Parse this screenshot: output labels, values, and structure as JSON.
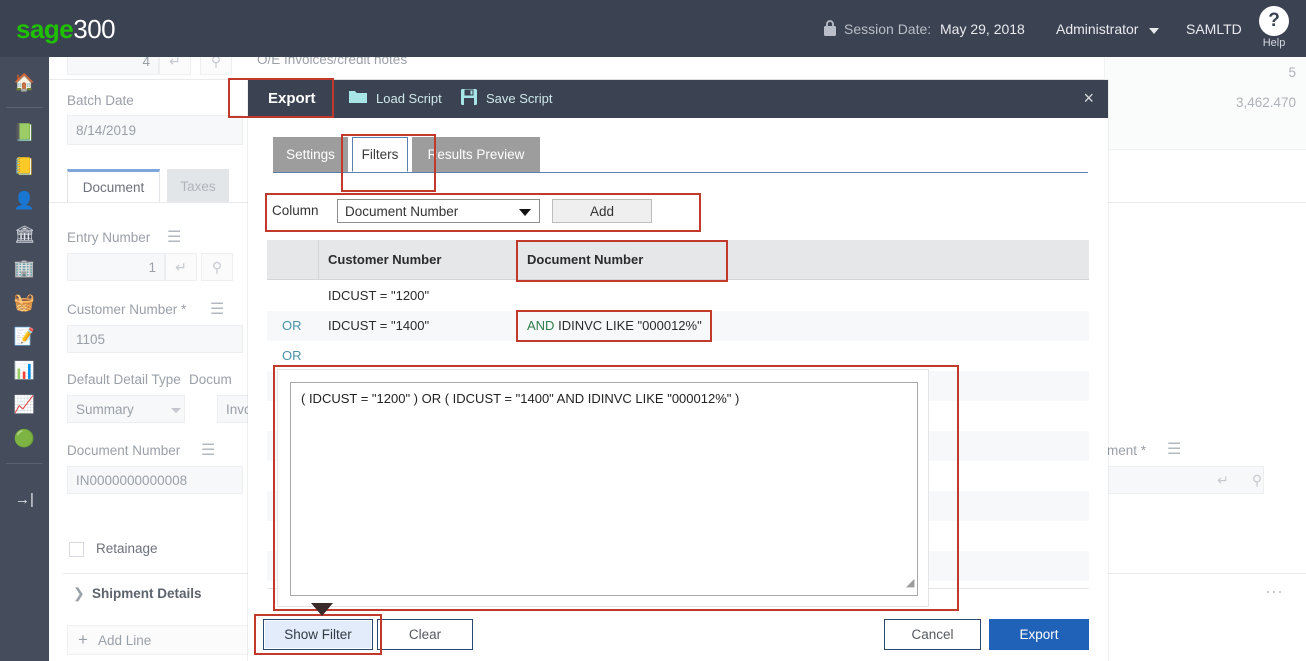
{
  "topbar": {
    "logo_sage": "sage",
    "logo_num": "300",
    "session_label": "Session Date:",
    "session_date": "May 29, 2018",
    "user": "Administrator",
    "company": "SAMLTD",
    "help_glyph": "?",
    "help_label": "Help",
    "bg_color": "#3b4251",
    "accent_green": "#1ec000"
  },
  "rail": {
    "items": [
      {
        "name": "home",
        "glyph": "🏠"
      },
      {
        "name": "accounts-payable",
        "glyph": "📗"
      },
      {
        "name": "accounts-receivable",
        "glyph": "📒"
      },
      {
        "name": "administrative-services",
        "glyph": "👤"
      },
      {
        "name": "bank-services",
        "glyph": "🏛"
      },
      {
        "name": "common-services",
        "glyph": "🏢"
      },
      {
        "name": "inventory-control",
        "glyph": "🧺"
      },
      {
        "name": "order-entry",
        "glyph": "📝"
      },
      {
        "name": "purchase-orders",
        "glyph": "📊"
      },
      {
        "name": "project-job-costing",
        "glyph": "📈"
      },
      {
        "name": "tax-services",
        "glyph": "🟢"
      },
      {
        "name": "collapse-menu",
        "glyph": "→|"
      }
    ]
  },
  "background_form": {
    "top_field_value": "4",
    "top_description": "O/E Invoices/credit notes",
    "batch_date_label": "Batch Date",
    "batch_date_value": "8/14/2019",
    "tabs": [
      {
        "label": "Document",
        "active": true
      },
      {
        "label": "Taxes",
        "active": false
      }
    ],
    "entry_number_label": "Entry Number",
    "entry_number_value": "1",
    "customer_number_label": "Customer Number *",
    "customer_number_value": "1105",
    "default_detail_type_label": "Default Detail Type",
    "default_detail_type_value": "Summary",
    "document_type_label": "Docum",
    "document_type_value": "Invoi",
    "document_number_label": "Document Number",
    "document_number_value": "IN0000000000008",
    "retainage_label": "Retainage",
    "shipment_details_label": "Shipment Details",
    "add_line_label": "Add Line",
    "right_value_count": "5",
    "right_value_amount": "3,462.470",
    "right_label_partial": "ment *"
  },
  "modal": {
    "title": "Export",
    "load_script_label": "Load Script",
    "save_script_label": "Save Script",
    "close_glyph": "×",
    "tabs": [
      {
        "label": "Settings",
        "active": false
      },
      {
        "label": "Filters",
        "active": true
      },
      {
        "label": "Results Preview",
        "active": false
      }
    ],
    "column_label": "Column",
    "column_value": "Document Number",
    "add_button": "Add",
    "grid": {
      "headers": [
        "",
        "Customer Number",
        "Document Number"
      ],
      "rows": [
        {
          "op": "",
          "customer": "IDCUST = \"1200\"",
          "document": ""
        },
        {
          "op": "OR",
          "customer": "IDCUST = \"1400\"",
          "document_op": "AND",
          "document": "IDINVC LIKE \"000012%\""
        },
        {
          "op": "OR",
          "customer": "",
          "document": ""
        }
      ]
    },
    "filter_expression": "( IDCUST = \"1200\" ) OR ( IDCUST = \"1400\" AND IDINVC LIKE \"000012%\" )",
    "footer": {
      "show_filter": "Show Filter",
      "clear": "Clear",
      "cancel": "Cancel",
      "export": "Export"
    },
    "primary_color": "#1f62b8",
    "header_color": "#3b4251"
  },
  "annotation": {
    "color": "#c0392b"
  }
}
